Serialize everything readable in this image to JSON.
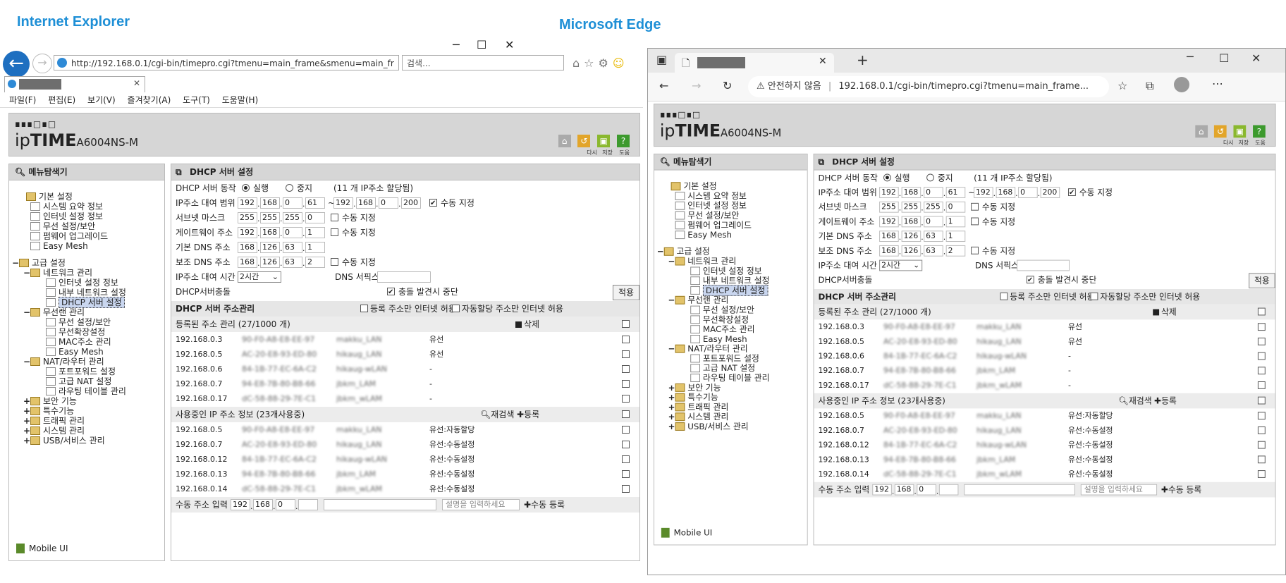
{
  "captions": {
    "ie": "Internet Explorer",
    "edge": "Microsoft Edge"
  },
  "ie": {
    "url": "http://192.168.0.1/cgi-bin/timepro.cgi?tmenu=main_frame&smenu=main_fr",
    "search_placeholder": "검색...",
    "menu": [
      "파일(F)",
      "편집(E)",
      "보기(V)",
      "즐겨찾기(A)",
      "도구(T)",
      "도움말(H)"
    ]
  },
  "edge": {
    "not_secure": "안전하지 않음",
    "url": "192.168.0.1/cgi-bin/timepro.cgi?tmenu=main_frame..."
  },
  "router": {
    "logo_dots": "∎∎∎□∎□",
    "logo_ip": "ip",
    "logo_time": "TIME",
    "model": "A6004NS-M",
    "header_labels": [
      "다시",
      "저장",
      "도움"
    ],
    "sidebar_title": "메뉴탐색기",
    "mobile_ui": "Mobile UI",
    "tree": [
      {
        "depth": 0,
        "pm": "",
        "icon": "fold",
        "label": "기본 설정"
      },
      {
        "depth": 1,
        "pm": "",
        "icon": "pg",
        "label": "시스템 요약 정보"
      },
      {
        "depth": 1,
        "pm": "",
        "icon": "pg",
        "label": "인터넷 설정 정보"
      },
      {
        "depth": 1,
        "pm": "",
        "icon": "pg",
        "label": "무선 설정/보안"
      },
      {
        "depth": 1,
        "pm": "",
        "icon": "pg",
        "label": "펌웨어 업그레이드"
      },
      {
        "depth": 1,
        "pm": "",
        "icon": "pg",
        "label": "Easy Mesh"
      },
      {
        "depth": -1,
        "pm": "",
        "icon": "",
        "label": ""
      },
      {
        "depth": 0,
        "pm": "−",
        "icon": "fold",
        "label": "고급 설정"
      },
      {
        "depth": 1,
        "pm": "−",
        "icon": "fold",
        "label": "네트워크 관리"
      },
      {
        "depth": 2,
        "pm": "",
        "icon": "pg",
        "label": "인터넷 설정 정보"
      },
      {
        "depth": 2,
        "pm": "",
        "icon": "pg",
        "label": "내부 네트워크 설정"
      },
      {
        "depth": 2,
        "pm": "",
        "icon": "pg",
        "label": "DHCP 서버 설정",
        "selected": true
      },
      {
        "depth": 1,
        "pm": "−",
        "icon": "fold",
        "label": "무선랜 관리"
      },
      {
        "depth": 2,
        "pm": "",
        "icon": "pg",
        "label": "무선 설정/보안"
      },
      {
        "depth": 2,
        "pm": "",
        "icon": "pg",
        "label": "무선확장설정"
      },
      {
        "depth": 2,
        "pm": "",
        "icon": "pg",
        "label": "MAC주소 관리"
      },
      {
        "depth": 2,
        "pm": "",
        "icon": "pg",
        "label": "Easy Mesh"
      },
      {
        "depth": 1,
        "pm": "−",
        "icon": "fold",
        "label": "NAT/라우터 관리"
      },
      {
        "depth": 2,
        "pm": "",
        "icon": "pg",
        "label": "포트포워드 설정"
      },
      {
        "depth": 2,
        "pm": "",
        "icon": "pg",
        "label": "고급 NAT 설정"
      },
      {
        "depth": 2,
        "pm": "",
        "icon": "pg",
        "label": "라우팅 테이블 관리"
      },
      {
        "depth": 1,
        "pm": "+",
        "icon": "fold",
        "label": "보안 기능"
      },
      {
        "depth": 1,
        "pm": "+",
        "icon": "fold",
        "label": "특수기능"
      },
      {
        "depth": 1,
        "pm": "+",
        "icon": "fold",
        "label": "트래픽 관리"
      },
      {
        "depth": 1,
        "pm": "+",
        "icon": "fold",
        "label": "시스템 관리"
      },
      {
        "depth": 1,
        "pm": "+",
        "icon": "fold",
        "label": "USB/서비스 관리"
      }
    ],
    "main_title": "DHCP 서버 설정",
    "dhcp_op_label": "DHCP 서버 동작",
    "run": "실행",
    "stop": "중지",
    "ip_count": "(11 개 IP주소 할당됨)",
    "range_label": "IP주소 대여 범위",
    "range_start": [
      "192",
      "168",
      "0",
      "61"
    ],
    "range_end": [
      "192",
      "168",
      "0",
      "200"
    ],
    "manual": "수동 지정",
    "subnet_label": "서브넷 마스크",
    "subnet": [
      "255",
      "255",
      "255",
      "0"
    ],
    "gw_label": "게이트웨이 주소",
    "gw": [
      "192",
      "168",
      "0",
      "1"
    ],
    "dns1_label": "기본 DNS 주소",
    "dns1": [
      "168",
      "126",
      "63",
      "1"
    ],
    "dns2_label": "보조 DNS 주소",
    "dns2": [
      "168",
      "126",
      "63",
      "2"
    ],
    "lease_label": "IP주소 대여 시간",
    "lease": "2시간",
    "dns_suffix_label": "DNS 서픽스",
    "conflict_label": "DHCP서버충돌",
    "conflict_stop": "충돌 발견시 중단",
    "apply": "적용",
    "addr_mgmt_title": "DHCP 서버 주소관리",
    "allow_registered": "등록 주소만 인터넷 허용",
    "allow_auto": "자동할당 주소만 인터넷 허용",
    "registered_title": "등록된 주소 관리 (27/1000 개)",
    "delete": "삭제",
    "registered": [
      {
        "ip": "192.168.0.3",
        "mac": "90-F0-A8-E8-EE-97",
        "name": "makku_LAN",
        "type": "유선"
      },
      {
        "ip": "192.168.0.5",
        "mac": "AC-20-E8-93-ED-80",
        "name": "hikaug_LAN",
        "type": "유선"
      },
      {
        "ip": "192.168.0.6",
        "mac": "84-1B-77-EC-6A-C2",
        "name": "hikaug-wLAN",
        "type": "-"
      },
      {
        "ip": "192.168.0.7",
        "mac": "94-E8-7B-80-B8-66",
        "name": "jbkm_LAM",
        "type": "-"
      },
      {
        "ip": "192.168.0.17",
        "mac": "dC-58-88-29-7E-C1",
        "name": "jbkm_wLAM",
        "type": "-"
      }
    ],
    "inuse_title": "사용중인 IP 주소 정보 (23개사용중)",
    "rescan": "재검색",
    "register": "등록",
    "inuse": [
      {
        "ip": "192.168.0.5",
        "mac": "90-F0-A8-E8-EE-97",
        "name": "makku_LAN",
        "type": "유선:자동할당"
      },
      {
        "ip": "192.168.0.7",
        "mac": "AC-20-E8-93-ED-80",
        "name": "hikaug_LAN",
        "type": "유선:수동설정"
      },
      {
        "ip": "192.168.0.12",
        "mac": "84-1B-77-EC-6A-C2",
        "name": "hikaug-wLAN",
        "type": "유선:수동설정"
      },
      {
        "ip": "192.168.0.13",
        "mac": "94-E8-7B-80-B8-66",
        "name": "jbkm_LAM",
        "type": "유선:수동설정"
      },
      {
        "ip": "192.168.0.14",
        "mac": "dC-58-88-29-7E-C1",
        "name": "jbkm_wLAM",
        "type": "유선:수동설정"
      }
    ],
    "manual_input_label": "수동 주소 입력",
    "manual_ip": [
      "192",
      "168",
      "0",
      ""
    ],
    "desc_placeholder": "설명을 입력하세요",
    "manual_register": "수동 등록"
  }
}
